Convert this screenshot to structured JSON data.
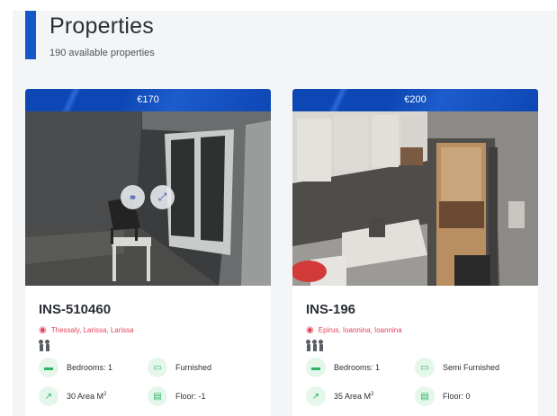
{
  "header": {
    "title": "Properties",
    "subtitle": "190 available properties"
  },
  "colors": {
    "accent": "#1657c7",
    "price_bar": "#0d47b5",
    "location": "#e2455c",
    "feature_icon": "#2fb463"
  },
  "cards": [
    {
      "price": "€170",
      "ref": "INS-510460",
      "location": "Thessaly, Larissa, Larissa",
      "guests": 2,
      "features": {
        "bedrooms": "Bedrooms: 1",
        "furnishing": "Furnished",
        "area_label": "30 Area M",
        "area_sup": "2",
        "floor": "Floor: -1"
      },
      "overlay": [
        "link-icon",
        "expand-icon"
      ]
    },
    {
      "price": "€200",
      "ref": "INS-196",
      "location": "Epirus, Ioannina, Ioannina",
      "guests": 3,
      "features": {
        "bedrooms": "Bedrooms: 1",
        "furnishing": "Semi Furnished",
        "area_label": "35 Area M",
        "area_sup": "2",
        "floor": "Floor: 0"
      }
    }
  ]
}
